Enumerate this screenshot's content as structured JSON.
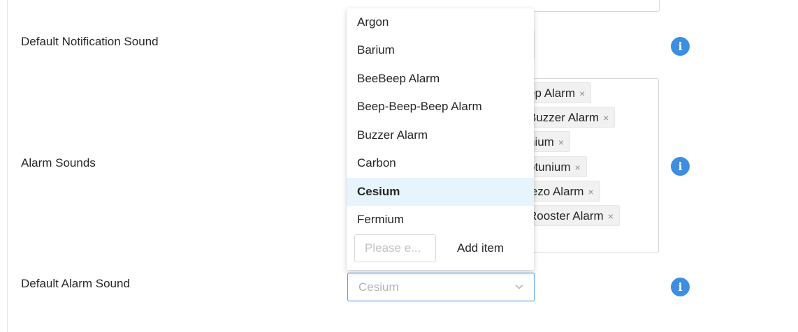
{
  "rows": {
    "notification": {
      "label": "Default Notification Sound"
    },
    "alarm_sounds": {
      "label": "Alarm Sounds"
    },
    "default_alarm": {
      "label": "Default Alarm Sound"
    }
  },
  "info_icon_glyph": "i",
  "alarm_tags": [
    {
      "label": "ep Alarm",
      "remove": "×"
    },
    {
      "label": "Buzzer Alarm",
      "remove": "×"
    },
    {
      "label": "nium",
      "remove": "×"
    },
    {
      "label": "otunium",
      "remove": "×"
    },
    {
      "label": "iezo Alarm",
      "remove": "×"
    },
    {
      "label": "Rooster Alarm",
      "remove": "×"
    }
  ],
  "dropdown": {
    "options": [
      "Argon",
      "Barium",
      "BeeBeep Alarm",
      "Beep-Beep-Beep Alarm",
      "Buzzer Alarm",
      "Carbon",
      "Cesium",
      "Fermium"
    ],
    "active_option": "Cesium",
    "add_input_placeholder": "Please e...",
    "add_button_label": "Add item"
  },
  "default_alarm_select": {
    "value": "Cesium"
  },
  "colors": {
    "info_icon": "#3d8ee0",
    "active_option_bg": "#e6f4fd",
    "select_focus_border": "#5aa3ec"
  }
}
